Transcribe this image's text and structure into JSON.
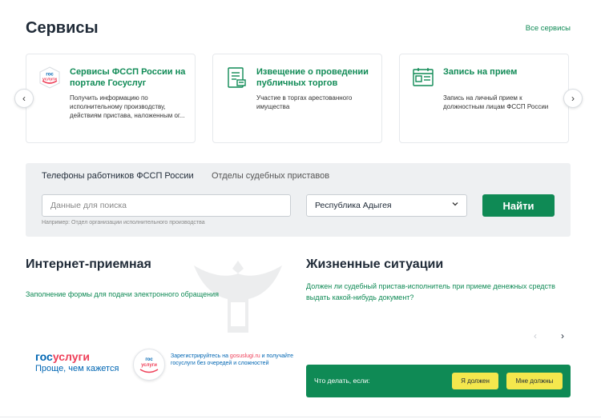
{
  "header": {
    "title": "Сервисы",
    "all_services": "Все сервисы"
  },
  "cards": [
    {
      "icon": "gosuslugi-icon",
      "icon_text_1": "гос",
      "icon_text_2": "услуги",
      "title": "Сервисы ФССП России на портале Госуслуг",
      "desc": "Получить информацию по исполнительному производству, действиям пристава, наложенным ог..."
    },
    {
      "icon": "auction-document-icon",
      "title": "Извещение о проведении публичных торгов",
      "desc": "Участие в торгах арестованного имущества"
    },
    {
      "icon": "appointment-icon",
      "title": "Запись на прием",
      "desc": "Запись на личный прием к должностным лицам ФССП России"
    }
  ],
  "carousel": {
    "prev": "‹",
    "next": "›"
  },
  "search": {
    "tabs": [
      "Телефоны работников ФССП России",
      "Отделы судебных приставов"
    ],
    "placeholder": "Данные для поиска",
    "region": "Республика Адыгея",
    "button": "Найти",
    "hint": "Например: Отдел организации исполнительного производства"
  },
  "reception": {
    "title": "Интернет-приемная",
    "link": "Заполнение формы для подачи электронного обращения"
  },
  "gosuslugi": {
    "logo_part1": "гос",
    "logo_part2": "услуги",
    "slogan": "Проще, чем кажется",
    "badge_1": "гос",
    "badge_2": "услуги",
    "reg_prefix": "Зарегистрируйтесь на ",
    "reg_link": "gosuslugi.ru",
    "reg_suffix": " и получайте госуслуги без очередей и сложностей"
  },
  "situations": {
    "title": "Жизненные ситуации",
    "question": "Должен ли судебный пристав-исполнитель при приеме денежных средств выдать какой-нибудь документ?",
    "nav_prev": "‹",
    "nav_next": "›",
    "bar_question": "Что делать, если:",
    "btn_1": "Я должен",
    "btn_2": "Мне должны"
  },
  "colors": {
    "brand_green": "#0f8a55",
    "accent_yellow": "#f4e74d",
    "gos_blue": "#0066b3",
    "gos_red": "#ee3f58"
  }
}
